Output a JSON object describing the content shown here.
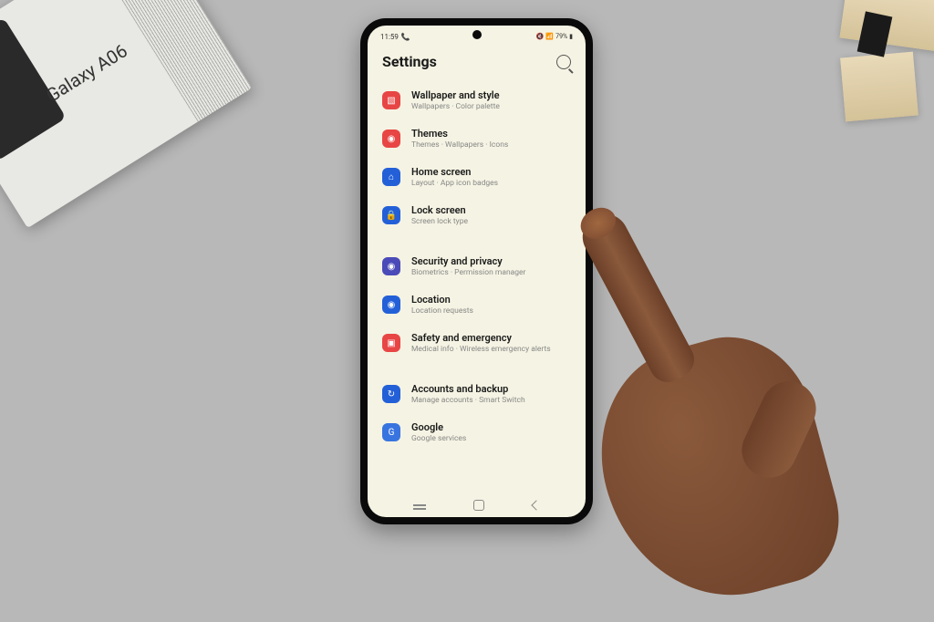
{
  "status_bar": {
    "time": "11:59",
    "battery": "79%"
  },
  "header": {
    "title": "Settings"
  },
  "settings": [
    {
      "icon_color": "#e84545",
      "glyph": "▧",
      "title": "Wallpaper and style",
      "subtitle": "Wallpapers · Color palette"
    },
    {
      "icon_color": "#e84545",
      "glyph": "◉",
      "title": "Themes",
      "subtitle": "Themes · Wallpapers · Icons"
    },
    {
      "icon_color": "#2360d8",
      "glyph": "⌂",
      "title": "Home screen",
      "subtitle": "Layout · App icon badges"
    },
    {
      "icon_color": "#2360d8",
      "glyph": "🔒",
      "title": "Lock screen",
      "subtitle": "Screen lock type"
    }
  ],
  "settings2": [
    {
      "icon_color": "#4a4ab8",
      "glyph": "◉",
      "title": "Security and privacy",
      "subtitle": "Biometrics · Permission manager"
    },
    {
      "icon_color": "#2360d8",
      "glyph": "◉",
      "title": "Location",
      "subtitle": "Location requests"
    },
    {
      "icon_color": "#e84545",
      "glyph": "▣",
      "title": "Safety and emergency",
      "subtitle": "Medical info · Wireless emergency alerts"
    }
  ],
  "settings3": [
    {
      "icon_color": "#2360d8",
      "glyph": "↻",
      "title": "Accounts and backup",
      "subtitle": "Manage accounts · Smart Switch"
    },
    {
      "icon_color": "#3874e0",
      "glyph": "G",
      "title": "Google",
      "subtitle": "Google services"
    }
  ],
  "box_label": "Galaxy A06"
}
